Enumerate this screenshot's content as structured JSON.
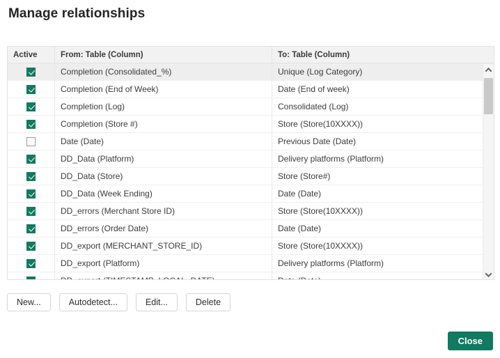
{
  "dialog": {
    "title": "Manage relationships"
  },
  "table": {
    "columns": {
      "active": "Active",
      "from": "From: Table (Column)",
      "to": "To: Table (Column)"
    },
    "rows": [
      {
        "active": true,
        "from": "Completion (Consolidated_%)",
        "to": "Unique (Log Category)",
        "selected": true
      },
      {
        "active": true,
        "from": "Completion (End of Week)",
        "to": "Date (End of week)",
        "selected": false
      },
      {
        "active": true,
        "from": "Completion (Log)",
        "to": "Consolidated (Log)",
        "selected": false
      },
      {
        "active": true,
        "from": "Completion (Store #)",
        "to": "Store (Store(10XXXX))",
        "selected": false
      },
      {
        "active": false,
        "from": "Date (Date)",
        "to": "Previous Date (Date)",
        "selected": false
      },
      {
        "active": true,
        "from": "DD_Data (Platform)",
        "to": "Delivery platforms (Platform)",
        "selected": false
      },
      {
        "active": true,
        "from": "DD_Data (Store)",
        "to": "Store (Store#)",
        "selected": false
      },
      {
        "active": true,
        "from": "DD_Data (Week Ending)",
        "to": "Date (Date)",
        "selected": false
      },
      {
        "active": true,
        "from": "DD_errors (Merchant Store ID)",
        "to": "Store (Store(10XXXX))",
        "selected": false
      },
      {
        "active": true,
        "from": "DD_errors (Order Date)",
        "to": "Date (Date)",
        "selected": false
      },
      {
        "active": true,
        "from": "DD_export (MERCHANT_STORE_ID)",
        "to": "Store (Store(10XXXX))",
        "selected": false
      },
      {
        "active": true,
        "from": "DD_export (Platform)",
        "to": "Delivery platforms (Platform)",
        "selected": false
      },
      {
        "active": true,
        "from": "DD_export (TIMESTAMP_LOCAL_DATE)",
        "to": "Date (Date)",
        "selected": false
      }
    ]
  },
  "actions": {
    "new": "New...",
    "autodetect": "Autodetect...",
    "edit": "Edit...",
    "delete": "Delete",
    "close": "Close"
  },
  "colors": {
    "accent": "#117a60",
    "header_bg": "#f2f2f2",
    "selected_row": "#eeeeee"
  }
}
